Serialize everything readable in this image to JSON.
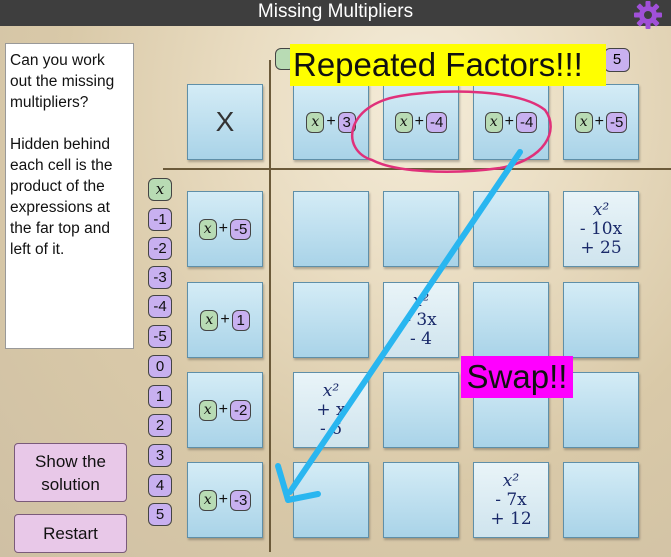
{
  "title": "Missing Multipliers",
  "instructions": "Can you work out the missing multipliers?\n\nHidden behind each cell is the product of the expressions at the far top and left of it.",
  "buttons": {
    "show_solution": "Show the solution",
    "restart": "Restart"
  },
  "corner_label": "X",
  "hidden_chip_right": "5",
  "top_headers": [
    {
      "var": "x",
      "op": "+",
      "num": "3"
    },
    {
      "var": "x",
      "op": "+",
      "num": "-4"
    },
    {
      "var": "x",
      "op": "+",
      "num": "-4"
    },
    {
      "var": "x",
      "op": "+",
      "num": "-5"
    }
  ],
  "left_headers": [
    {
      "var": "x",
      "op": "+",
      "num": "-5"
    },
    {
      "var": "x",
      "op": "+",
      "num": "1"
    },
    {
      "var": "x",
      "op": "+",
      "num": "-2"
    },
    {
      "var": "x",
      "op": "+",
      "num": "-3"
    }
  ],
  "palette": [
    "x",
    "-1",
    "-2",
    "-3",
    "-4",
    "-5",
    "0",
    "1",
    "2",
    "3",
    "4",
    "5"
  ],
  "revealed": [
    {
      "row": 0,
      "col": 3,
      "lines": [
        "x²",
        "- 10x",
        "+ 25"
      ]
    },
    {
      "row": 1,
      "col": 1,
      "lines": [
        "x²",
        "- 3x",
        "- 4"
      ]
    },
    {
      "row": 2,
      "col": 0,
      "lines": [
        "x²",
        "+ x",
        "- 6"
      ]
    },
    {
      "row": 3,
      "col": 2,
      "lines": [
        "x²",
        "- 7x",
        "+ 12"
      ]
    }
  ],
  "annotations": {
    "repeated": "Repeated Factors!!!",
    "swap": "Swap!!"
  },
  "colors": {
    "highlight_yellow": "#ffff00",
    "highlight_magenta": "#ff00ff",
    "circle": "#e0307a",
    "arrow": "#29b6f0"
  }
}
